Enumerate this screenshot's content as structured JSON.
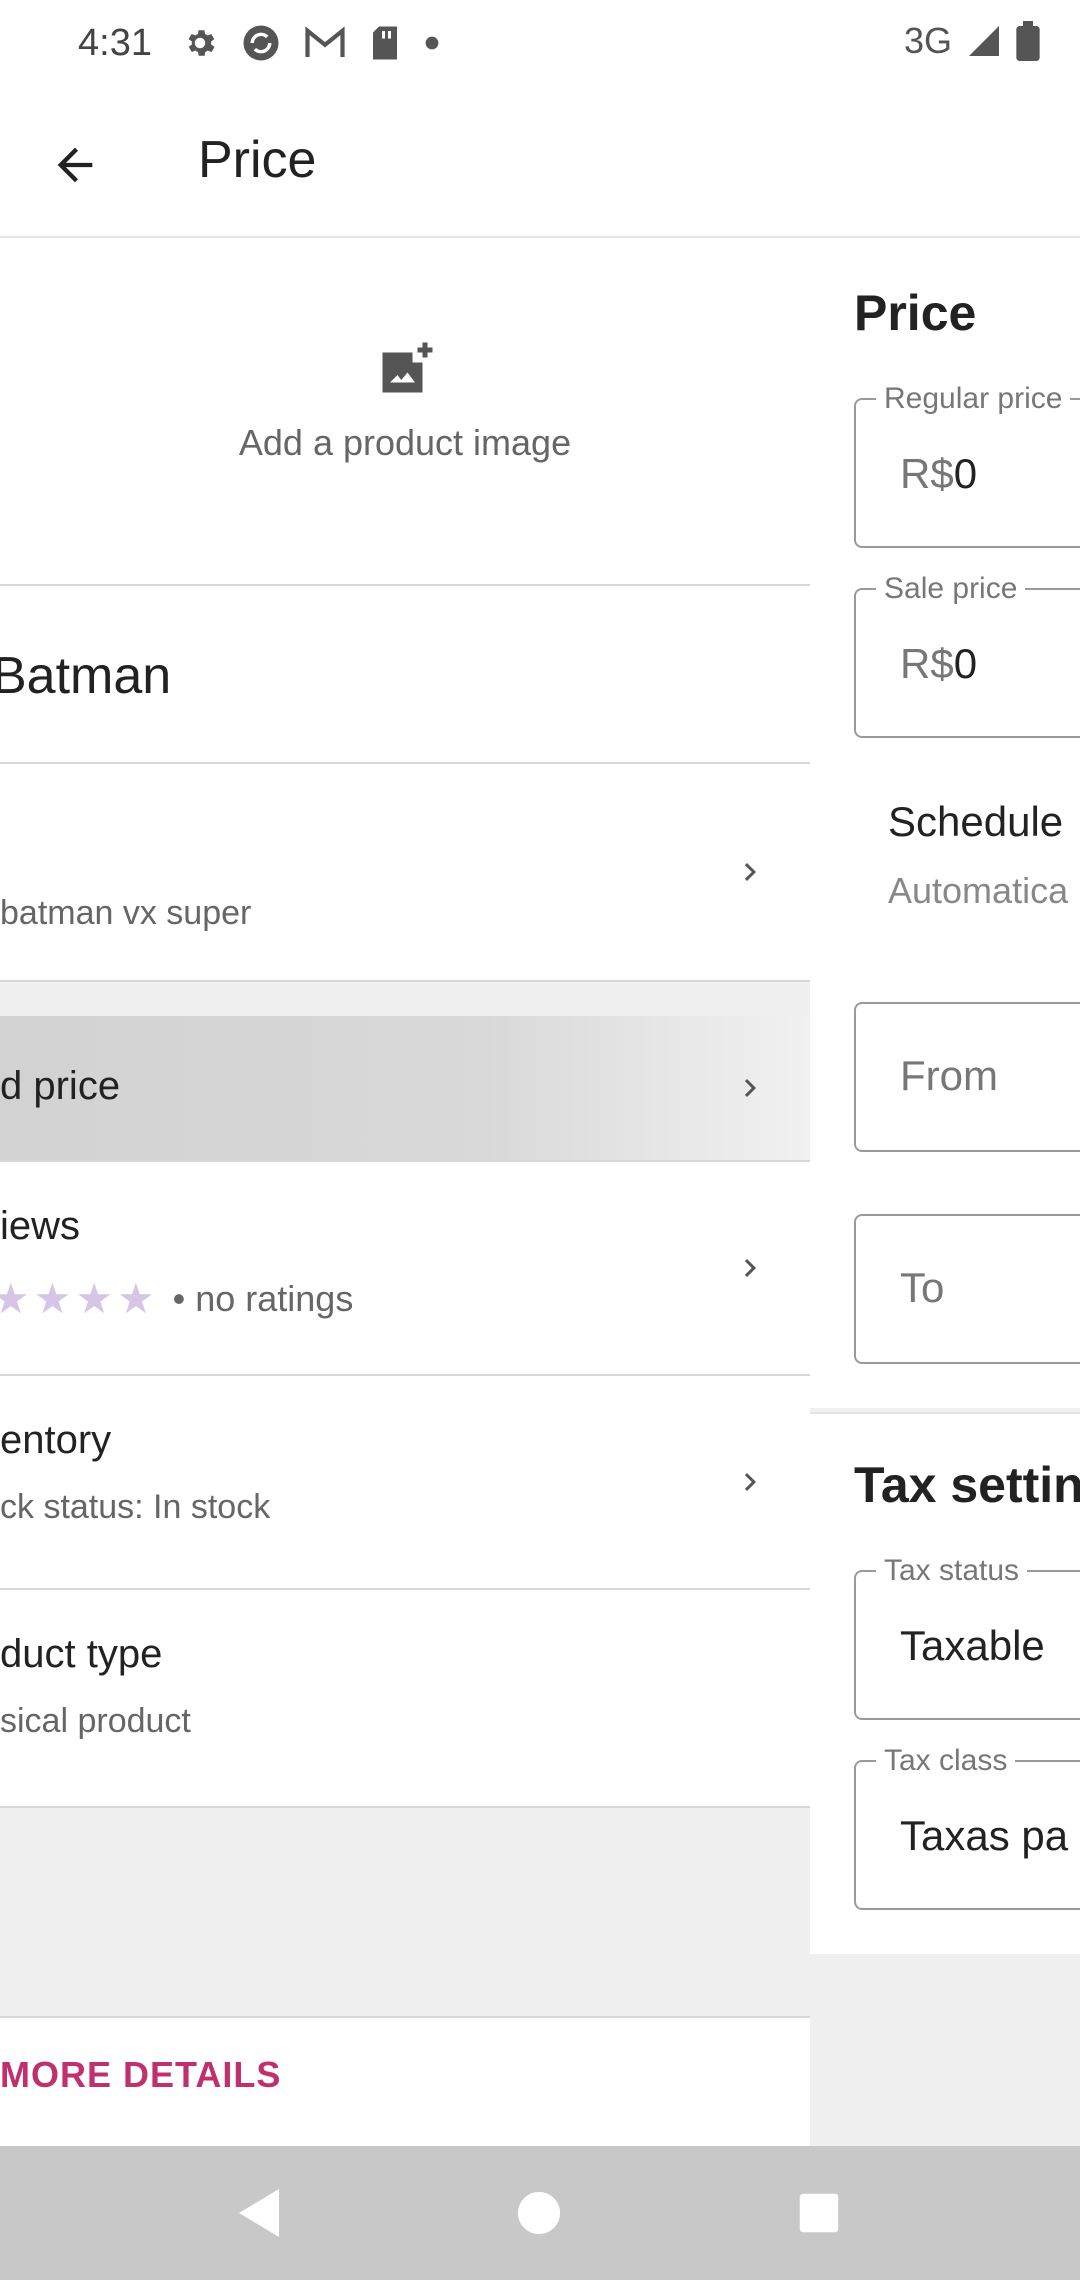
{
  "status_bar": {
    "time": "4:31",
    "network": "3G",
    "icons": [
      "settings-icon",
      "sync-icon",
      "gmail-icon",
      "sd-card-icon",
      "dot-icon",
      "signal-icon",
      "battery-icon"
    ]
  },
  "app_bar": {
    "title": "Price",
    "back_icon": "arrow-back-icon"
  },
  "left_panel": {
    "add_image_label": "Add a product image",
    "product_title": "Batman",
    "description": "batman vx super",
    "price_row_label": "d price",
    "reviews_label": "iews",
    "reviews_sub": "• no ratings",
    "inventory_label": "entory",
    "inventory_sub": "ck status: In stock",
    "product_type_label": "duct type",
    "product_type_sub": "sical product",
    "more_details": "MORE DETAILS"
  },
  "price_section": {
    "title": "Price",
    "regular_price_label": "Regular price",
    "regular_price_prefix": "R$",
    "regular_price_value": "0",
    "sale_price_label": "Sale price",
    "sale_price_prefix": "R$",
    "sale_price_value": "0",
    "schedule_title": "Schedule",
    "schedule_sub": "Automatica",
    "from_placeholder": "From",
    "to_placeholder": "To"
  },
  "tax_section": {
    "title": "Tax settin",
    "tax_status_label": "Tax status",
    "tax_status_value": "Taxable",
    "tax_class_label": "Tax class",
    "tax_class_value": "Taxas pa"
  },
  "colors": {
    "accent": "#c0306e",
    "star": "#d7c5e6"
  }
}
